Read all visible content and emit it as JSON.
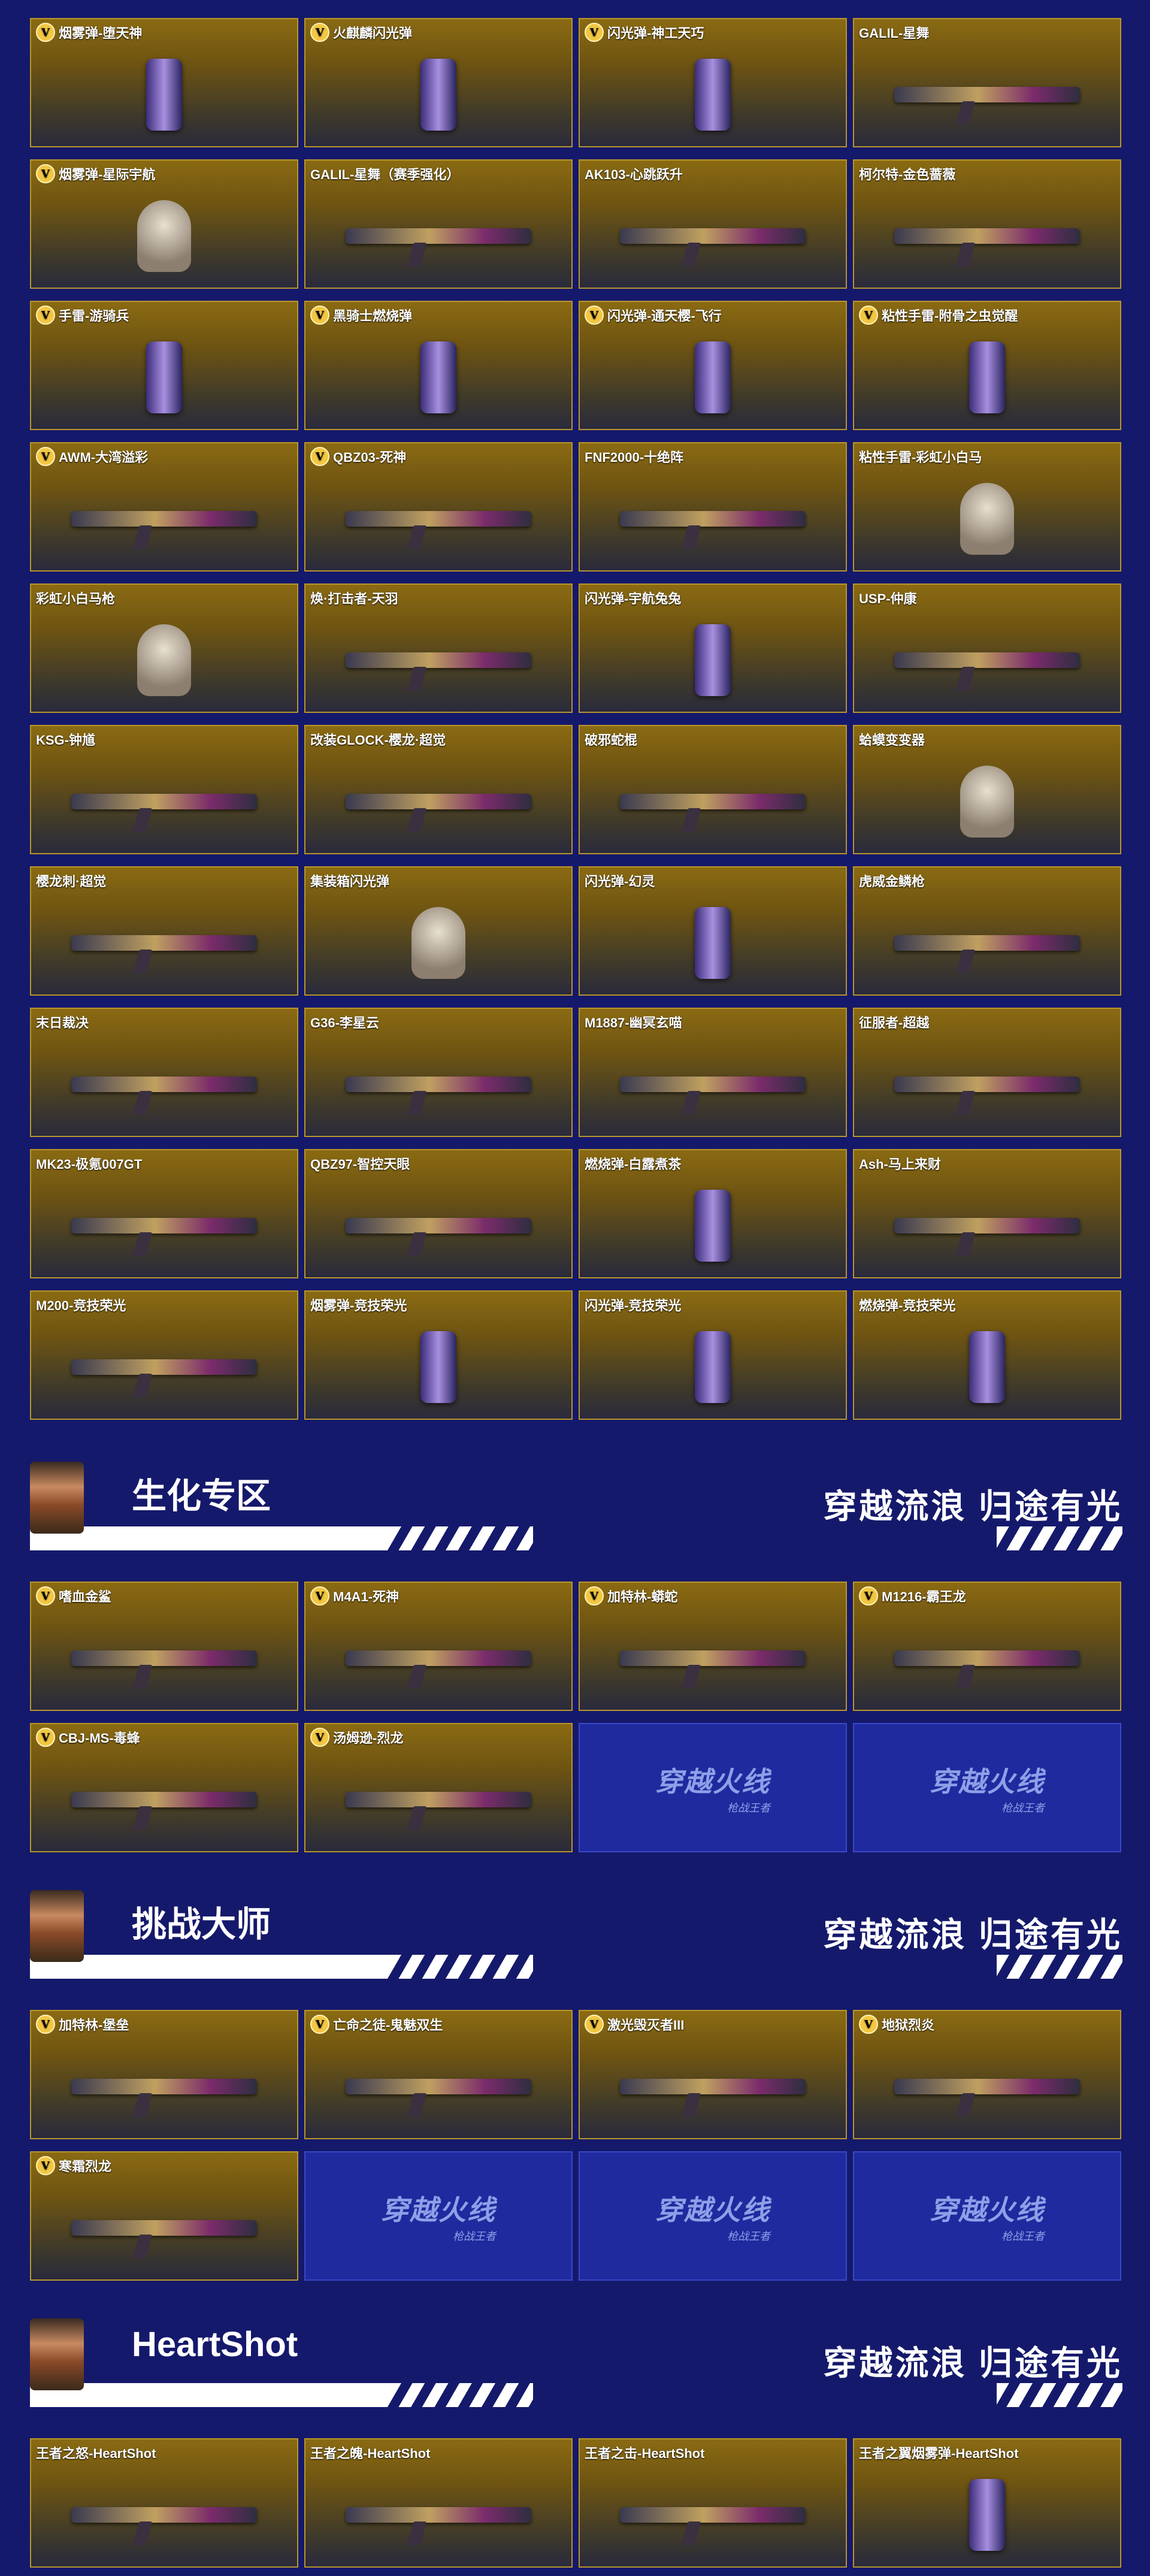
{
  "grids": [
    {
      "items": [
        {
          "name": "烟雾弹-堕天神",
          "v": true,
          "icon": "smoke-grenade-icon"
        },
        {
          "name": "火麒麟闪光弹",
          "v": true,
          "icon": "flash-grenade-icon"
        },
        {
          "name": "闪光弹-神工天巧",
          "v": true,
          "icon": "flash-grenade-icon"
        },
        {
          "name": "GALIL-星舞",
          "v": false,
          "icon": "rifle-icon"
        },
        {
          "name": "烟雾弹-星际宇航",
          "v": true,
          "icon": "astronaut-figure-icon"
        },
        {
          "name": "GALIL-星舞（赛季强化）",
          "v": false,
          "icon": "rifle-icon"
        },
        {
          "name": "AK103-心跳跃升",
          "v": false,
          "icon": "rifle-icon"
        },
        {
          "name": "柯尔特-金色蔷薇",
          "v": false,
          "icon": "pistol-icon"
        },
        {
          "name": "手雷-游骑兵",
          "v": true,
          "icon": "grenade-icon"
        },
        {
          "name": "黑骑士燃烧弹",
          "v": true,
          "icon": "incendiary-grenade-icon"
        },
        {
          "name": "闪光弹-通天樱-飞行",
          "v": true,
          "icon": "flash-grenade-icon"
        },
        {
          "name": "粘性手雷-附骨之虫觉醒",
          "v": true,
          "icon": "sticky-grenade-icon"
        },
        {
          "name": "AWM-大湾溢彩",
          "v": true,
          "icon": "sniper-rifle-icon"
        },
        {
          "name": "QBZ03-死神",
          "v": true,
          "icon": "rifle-icon"
        },
        {
          "name": "FNF2000-十绝阵",
          "v": false,
          "icon": "rifle-icon"
        },
        {
          "name": "粘性手雷-彩虹小白马",
          "v": false,
          "icon": "horse-figure-icon"
        },
        {
          "name": "彩虹小白马枪",
          "v": false,
          "icon": "unicorn-figure-icon"
        },
        {
          "name": "焕·打击者-天羽",
          "v": false,
          "icon": "shotgun-icon"
        },
        {
          "name": "闪光弹-宇航兔兔",
          "v": false,
          "icon": "flash-grenade-icon"
        },
        {
          "name": "USP-仲康",
          "v": false,
          "icon": "pistol-icon"
        },
        {
          "name": "KSG-钟馗",
          "v": false,
          "icon": "shotgun-icon"
        },
        {
          "name": "改装GLOCK-樱龙·超觉",
          "v": false,
          "icon": "pistol-icon"
        },
        {
          "name": "破邪蛇棍",
          "v": false,
          "icon": "staff-icon"
        },
        {
          "name": "蛤蟆变变器",
          "v": false,
          "icon": "frog-figure-icon"
        },
        {
          "name": "樱龙刺·超觉",
          "v": false,
          "icon": "knife-icon"
        },
        {
          "name": "集装箱闪光弹",
          "v": false,
          "icon": "chibi-figure-icon"
        },
        {
          "name": "闪光弹-幻灵",
          "v": false,
          "icon": "flash-grenade-icon"
        },
        {
          "name": "虎威金鳞枪",
          "v": false,
          "icon": "rifle-icon"
        },
        {
          "name": "末日裁决",
          "v": false,
          "icon": "sword-icon"
        },
        {
          "name": "G36-李星云",
          "v": false,
          "icon": "rifle-icon"
        },
        {
          "name": "M1887-幽冥玄喵",
          "v": false,
          "icon": "shotgun-icon"
        },
        {
          "name": "征服者-超越",
          "v": false,
          "icon": "rifle-icon"
        },
        {
          "name": "MK23-极氪007GT",
          "v": false,
          "icon": "pistol-icon"
        },
        {
          "name": "QBZ97-智控天眼",
          "v": false,
          "icon": "rifle-icon"
        },
        {
          "name": "燃烧弹-白露煮茶",
          "v": false,
          "icon": "incendiary-grenade-icon"
        },
        {
          "name": "Ash-马上来财",
          "v": false,
          "icon": "rifle-icon"
        },
        {
          "name": "M200-竞技荣光",
          "v": false,
          "icon": "sniper-rifle-icon"
        },
        {
          "name": "烟雾弹-竞技荣光",
          "v": false,
          "icon": "smoke-grenade-icon"
        },
        {
          "name": "闪光弹-竞技荣光",
          "v": false,
          "icon": "flash-grenade-icon"
        },
        {
          "name": "燃烧弹-竞技荣光",
          "v": false,
          "icon": "incendiary-grenade-icon"
        }
      ]
    },
    {
      "items": [
        {
          "name": "嗜血金鲨",
          "v": true,
          "icon": "shark-gun-icon"
        },
        {
          "name": "M4A1-死神",
          "v": true,
          "icon": "rifle-icon"
        },
        {
          "name": "加特林-蟒蛇",
          "v": true,
          "icon": "gatling-icon"
        },
        {
          "name": "M1216-霸王龙",
          "v": true,
          "icon": "shotgun-icon"
        },
        {
          "name": "CBJ-MS-毒蜂",
          "v": true,
          "icon": "smg-icon"
        },
        {
          "name": "汤姆逊-烈龙",
          "v": true,
          "icon": "smg-icon"
        },
        {
          "placeholder": true
        },
        {
          "placeholder": true
        }
      ]
    },
    {
      "items": [
        {
          "name": "加特林-堡垒",
          "v": true,
          "icon": "gatling-icon"
        },
        {
          "name": "亡命之徒-鬼魅双生",
          "v": true,
          "icon": "rifle-icon"
        },
        {
          "name": "激光毁灭者III",
          "v": true,
          "icon": "rifle-icon"
        },
        {
          "name": "地狱烈炎",
          "v": true,
          "icon": "rifle-icon"
        },
        {
          "name": "寒霜烈龙",
          "v": true,
          "icon": "smg-icon"
        },
        {
          "placeholder": true
        },
        {
          "placeholder": true
        },
        {
          "placeholder": true
        }
      ]
    },
    {
      "items": [
        {
          "name": "王者之怒-HeartShot",
          "v": false,
          "icon": "sniper-rifle-icon"
        },
        {
          "name": "王者之魄-HeartShot",
          "v": false,
          "icon": "rifle-icon"
        },
        {
          "name": "王者之击-HeartShot",
          "v": false,
          "icon": "axe-icon"
        },
        {
          "name": "王者之翼烟雾弹-HeartShot",
          "v": false,
          "icon": "smoke-grenade-icon"
        }
      ]
    }
  ],
  "sections": [
    {
      "title": "生化专区",
      "slogan": "穿越流浪 归途有光"
    },
    {
      "title": "挑战大师",
      "slogan": "穿越流浪 归途有光"
    },
    {
      "title": "HeartShot",
      "slogan": "穿越流浪 归途有光"
    }
  ],
  "badge_label": "V",
  "placeholder_logo": {
    "main": "穿越火线",
    "sub": "枪战王者"
  },
  "colors": {
    "background": "#15196b",
    "card_border": "#b8952a",
    "badge": "#f3c742",
    "placeholder": "#1f2a9e"
  }
}
